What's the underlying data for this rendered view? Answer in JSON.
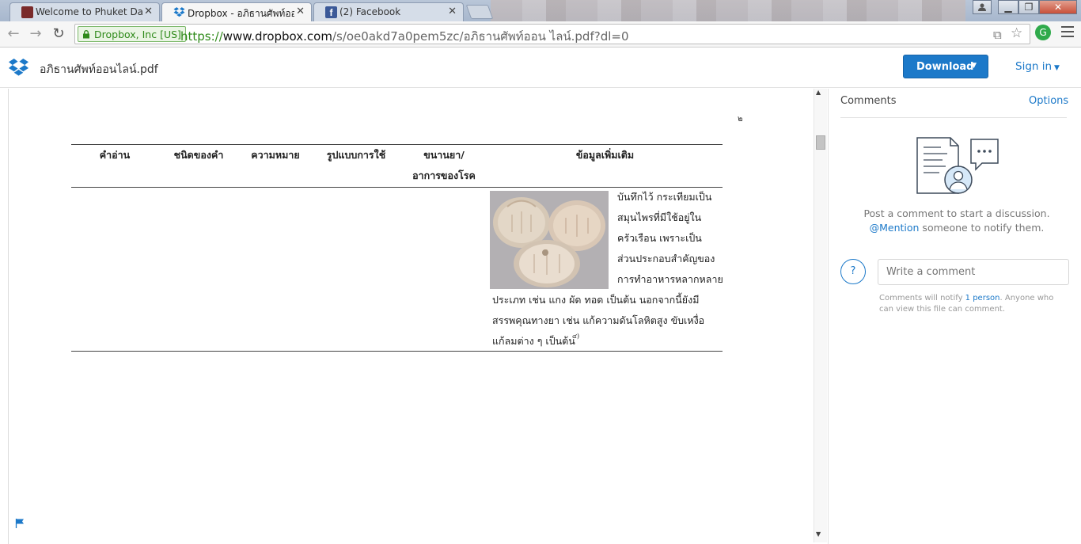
{
  "browser": {
    "tabs": [
      {
        "title": "Welcome to Phuket Data",
        "active": false,
        "favicon": "phuket-data-icon"
      },
      {
        "title": "Dropbox - อภิธานศัพท์ออนไ",
        "active": true,
        "favicon": "dropbox-icon"
      },
      {
        "title": "(2) Facebook",
        "active": false,
        "favicon": "facebook-icon"
      }
    ],
    "ev_label": "Dropbox, Inc [US]",
    "url_scheme": "https://",
    "url_host": "www.dropbox.com",
    "url_path": "/s/oe0akd7a0pem5zc/อภิธานศัพท์ออน ไลน์.pdf?dl=0"
  },
  "header": {
    "filename": "อภิธานศัพท์ออนไลน์.pdf",
    "download_label": "Download",
    "signin_label": "Sign in"
  },
  "document": {
    "page_number": "๒",
    "columns": [
      "คำอ่าน",
      "ชนิดของคำ",
      "ความหมาย",
      "รูปแบบการใช้",
      "ขนานยา/",
      "ข้อมูลเพิ่มเติม"
    ],
    "column5_line2": "อาการของโรค",
    "info_lines": [
      "บันทึกไว้ กระเทียมเป็น",
      "สมุนไพรที่มีใช้อยู่ใน",
      "ครัวเรือน เพราะเป็น",
      "ส่วนประกอบสำคัญของ",
      "การทำอาหารหลากหลาย",
      "ประเภท เช่น แกง ผัด ทอด เป็นต้น นอกจากนี้ยังมี",
      "สรรพคุณทางยา เช่น แก้ความดันโลหิตสูง ขับเหงื่อ",
      "แก้ลมต่าง ๆ เป็นต้น"
    ],
    "footnote_mark": "๔)"
  },
  "comments": {
    "title": "Comments",
    "options_label": "Options",
    "prompt_line1": "Post a comment to start a discussion.",
    "prompt_mention": "@Mention",
    "prompt_line2_rest": " someone to notify them.",
    "help_glyph": "?",
    "input_placeholder": "Write a comment",
    "note_prefix": "Comments will notify ",
    "note_link": "1 person",
    "note_suffix": ". Anyone who can view this file can comment."
  },
  "colors": {
    "accent": "#1c79c9",
    "ev_green": "#2f8a1a"
  }
}
